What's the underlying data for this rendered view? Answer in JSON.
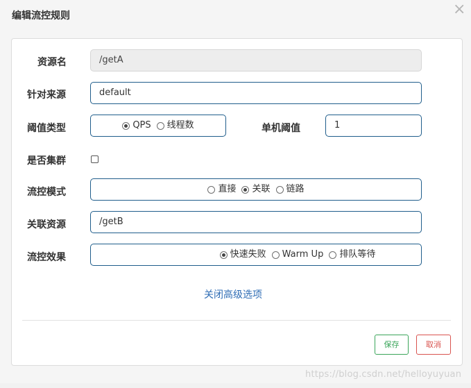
{
  "dialog": {
    "title": "编辑流控规则",
    "close_icon": "×"
  },
  "form": {
    "resource_name": {
      "label": "资源名",
      "value": "/getA"
    },
    "limit_app": {
      "label": "针对来源",
      "value": "default"
    },
    "threshold_type": {
      "label": "阈值类型",
      "options": [
        {
          "label": "QPS",
          "checked": true
        },
        {
          "label": "线程数",
          "checked": false
        }
      ]
    },
    "single_threshold": {
      "label": "单机阈值",
      "value": "1"
    },
    "cluster": {
      "label": "是否集群",
      "checked": false
    },
    "strategy": {
      "label": "流控模式",
      "options": [
        {
          "label": "直接",
          "checked": false
        },
        {
          "label": "关联",
          "checked": true
        },
        {
          "label": "链路",
          "checked": false
        }
      ]
    },
    "ref_resource": {
      "label": "关联资源",
      "value": "/getB"
    },
    "control_behavior": {
      "label": "流控效果",
      "options": [
        {
          "label": "快速失败",
          "checked": true
        },
        {
          "label": "Warm Up",
          "checked": false
        },
        {
          "label": "排队等待",
          "checked": false
        }
      ]
    },
    "advanced_toggle": "关闭高级选项"
  },
  "footer": {
    "save_label": "保存",
    "cancel_label": "取消"
  },
  "watermark": "https://blog.csdn.net/helloyuyuan"
}
